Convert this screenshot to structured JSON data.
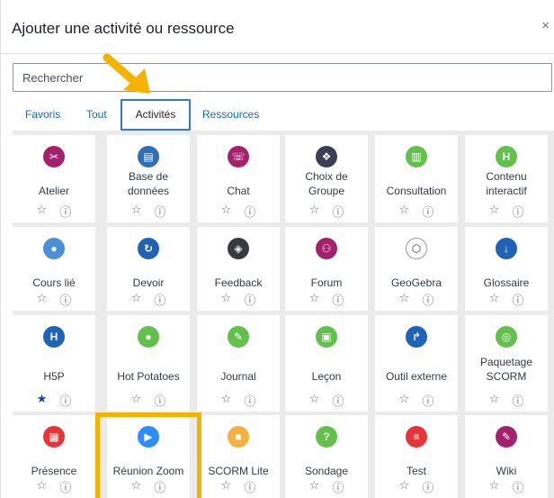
{
  "modal": {
    "title": "Ajouter une activité ou ressource",
    "close": "×"
  },
  "search": {
    "placeholder": "Rechercher"
  },
  "tabs": {
    "favoris": "Favoris",
    "tout": "Tout",
    "activites": "Activités",
    "ressources": "Ressources"
  },
  "items": [
    {
      "name": "Atelier",
      "icon": "tools-icon",
      "color": "#a4216c",
      "glyph": "✂"
    },
    {
      "name": "Base de\ndonnées",
      "icon": "database-icon",
      "color": "#2f6fb6",
      "glyph": "▤"
    },
    {
      "name": "Chat",
      "icon": "chat-icon",
      "color": "#a4216c",
      "glyph": "☏"
    },
    {
      "name": "Choix de\nGroupe",
      "icon": "group-icon",
      "color": "#3d3d55",
      "glyph": "❖"
    },
    {
      "name": "Consultation",
      "icon": "chart-icon",
      "color": "#63c04b",
      "glyph": "▥"
    },
    {
      "name": "Contenu\ninteractif",
      "icon": "h5p-icon",
      "color": "#63c04b",
      "glyph": "H"
    },
    {
      "name": "Cours lié",
      "icon": "linked-course-icon",
      "color": "#4a90d9",
      "glyph": "●"
    },
    {
      "name": "Devoir",
      "icon": "assignment-icon",
      "color": "#1f62b6",
      "glyph": "↻"
    },
    {
      "name": "Feedback",
      "icon": "feedback-icon",
      "color": "#343a40",
      "glyph": "◈"
    },
    {
      "name": "Forum",
      "icon": "forum-icon",
      "color": "#a4216c",
      "glyph": "⚇"
    },
    {
      "name": "GeoGebra",
      "icon": "geogebra-icon",
      "color": "#ffffff",
      "glyph": "⬡"
    },
    {
      "name": "Glossaire",
      "icon": "glossary-icon",
      "color": "#1f62b6",
      "glyph": "↓"
    },
    {
      "name": "H5P",
      "icon": "h5p-icon",
      "color": "#1f62b6",
      "glyph": "H"
    },
    {
      "name": "Hot Potatoes",
      "icon": "hotpot-icon",
      "color": "#63c04b",
      "glyph": "●"
    },
    {
      "name": "Journal",
      "icon": "journal-icon",
      "color": "#63c04b",
      "glyph": "✎"
    },
    {
      "name": "Leçon",
      "icon": "lesson-icon",
      "color": "#63c04b",
      "glyph": "▣"
    },
    {
      "name": "Outil externe",
      "icon": "external-tool-icon",
      "color": "#1f62b6",
      "glyph": "↱"
    },
    {
      "name": "Paquetage\nSCORM",
      "icon": "scorm-package-icon",
      "color": "#63c04b",
      "glyph": "◎"
    },
    {
      "name": "Présence",
      "icon": "attendance-icon",
      "color": "#e6353a",
      "glyph": "▦"
    },
    {
      "name": "Réunion Zoom",
      "icon": "zoom-icon",
      "color": "#2d8cff",
      "glyph": "▶"
    },
    {
      "name": "SCORM Lite",
      "icon": "scorm-lite-icon",
      "color": "#f5b041",
      "glyph": "■"
    },
    {
      "name": "Sondage",
      "icon": "survey-icon",
      "color": "#63c04b",
      "glyph": "?"
    },
    {
      "name": "Test",
      "icon": "quiz-icon",
      "color": "#e6353a",
      "glyph": "≡"
    },
    {
      "name": "Wiki",
      "icon": "wiki-icon",
      "color": "#a4216c",
      "glyph": "✎"
    }
  ],
  "starred": [
    "H5P"
  ]
}
